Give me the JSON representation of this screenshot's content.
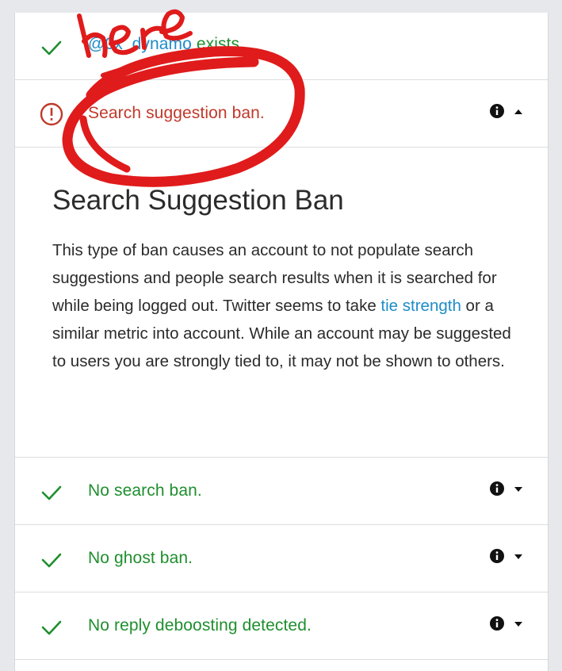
{
  "account_row": {
    "handle": "@0x_dynamo",
    "rest": " exists."
  },
  "suggestion_row": {
    "label": "Search suggestion ban."
  },
  "panel": {
    "title": "Search Suggestion Ban",
    "text_before_link": "This type of ban causes an account to not populate search suggestions and people search results when it is searched for while being logged out. Twitter seems to take ",
    "link_text": "tie strength",
    "text_after_link": " or a similar metric into account. While an account may be suggested to users you are strongly tied to, it may not be shown to others."
  },
  "rows": [
    {
      "label": "No search ban."
    },
    {
      "label": "No ghost ban."
    },
    {
      "label": "No reply deboosting detected."
    }
  ],
  "annotation": {
    "handwritten_text": "here"
  },
  "colors": {
    "ok": "#1f8f2e",
    "error": "#c0392b",
    "link": "#1d8cc9",
    "annotation": "#e01b1b"
  },
  "icons": {
    "ok": "check-icon",
    "error": "exclamation-circle-icon",
    "info": "info-icon",
    "expanded": "caret-up-icon",
    "collapsed": "caret-down-icon"
  }
}
